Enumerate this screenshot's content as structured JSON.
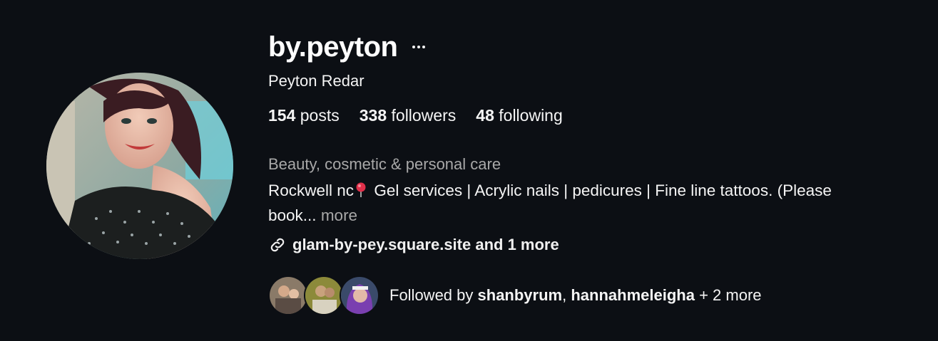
{
  "profile": {
    "username": "by.peyton",
    "more_icon": "more-horizontal-icon",
    "full_name": "Peyton Redar",
    "stats": {
      "posts_count": "154",
      "posts_label": "posts",
      "followers_count": "338",
      "followers_label": "followers",
      "following_count": "48",
      "following_label": "following"
    },
    "category": "Beauty, cosmetic & personal care",
    "bio": {
      "line1_pre": "Rockwell nc",
      "line1_post": "Gel services | Acrylic nails | pedicures | Fine line tattoos. (Please",
      "line2": "book...",
      "more_label": "more",
      "pin_icon": "round-pushpin-icon"
    },
    "link": {
      "icon": "link-icon",
      "url": "glam-by-pey.square.site",
      "extra": "and 1 more"
    },
    "followed_by": {
      "prefix": "Followed by",
      "user1": "shanbyrum",
      "separator": ",",
      "user2": "hannahmeleigha",
      "suffix": "+ 2 more"
    }
  },
  "colors": {
    "background": "#0c0f14",
    "text_primary": "#f5f5f5",
    "text_secondary": "#a8a8a8"
  }
}
